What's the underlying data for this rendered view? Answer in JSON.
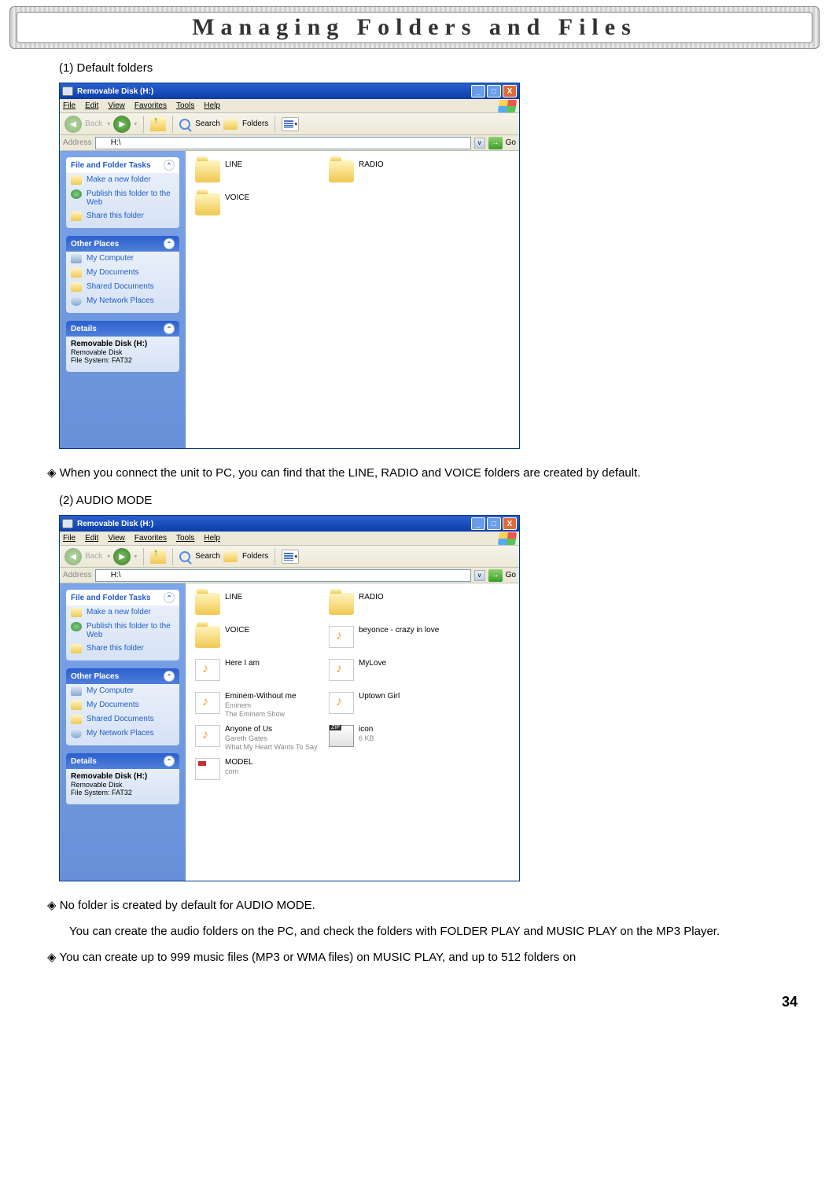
{
  "page": {
    "title": "Managing Folders and Files",
    "section1": "(1)  Default folders",
    "section2": "(2)   AUDIO MODE",
    "bullet1": "When you connect the unit to PC, you can find that the LINE, RADIO and VOICE folders are created by default.",
    "bullet2a": "No folder is created by default for AUDIO MODE.",
    "bullet2b": "You can create the audio folders on the PC, and check the folders with FOLDER PLAY and MUSIC PLAY on the MP3 Player.",
    "bullet3": "You can create up to 999 music files (MP3 or WMA files) on MUSIC PLAY, and up to 512 folders on",
    "pagenum": "34"
  },
  "win": {
    "title": "Removable Disk (H:)",
    "menus": {
      "file": "File",
      "edit": "Edit",
      "view": "View",
      "favorites": "Favorites",
      "tools": "Tools",
      "help": "Help"
    },
    "toolbar": {
      "back": "Back",
      "search": "Search",
      "folders": "Folders"
    },
    "address": {
      "label": "Address",
      "path": "H:\\",
      "go": "Go"
    },
    "tasks": {
      "title": "File and Folder Tasks",
      "items": [
        "Make a new folder",
        "Publish this folder to the Web",
        "Share this folder"
      ]
    },
    "places": {
      "title": "Other Places",
      "items": [
        "My Computer",
        "My Documents",
        "Shared Documents",
        "My Network Places"
      ]
    },
    "details": {
      "title": "Details",
      "name": "Removable Disk (H:)",
      "type": "Removable Disk",
      "fs": "File System: FAT32"
    }
  },
  "content1": [
    "LINE",
    "RADIO",
    "VOICE"
  ],
  "content2": [
    {
      "n": "LINE",
      "t": "folder"
    },
    {
      "n": "RADIO",
      "t": "folder"
    },
    {
      "n": "VOICE",
      "t": "folder"
    },
    {
      "n": "beyonce - crazy in love",
      "t": "mp3"
    },
    {
      "n": "Here I am",
      "t": "mp3"
    },
    {
      "n": "MyLove",
      "t": "mp3"
    },
    {
      "n": "Eminem-Without me",
      "s1": "Eminem",
      "s2": "The Eminem Show",
      "t": "mp3"
    },
    {
      "n": "Uptown Girl",
      "t": "mp3"
    },
    {
      "n": "Anyone of Us",
      "s1": "Gareth Gates",
      "s2": "What My Heart Wants To Say",
      "t": "mp3"
    },
    {
      "n": "icon",
      "s1": "6 KB",
      "t": "zip"
    },
    {
      "n": "MODEL",
      "s1": "com",
      "t": "model"
    }
  ]
}
